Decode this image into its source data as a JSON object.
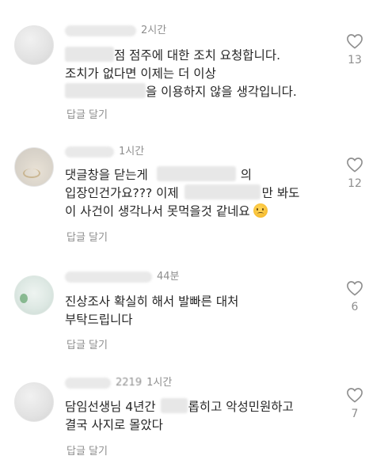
{
  "comments": [
    {
      "time": "2시간",
      "lines": [
        "점 점주에 대한 조치 요청합니다.",
        "조치가 없다면 이제는 더 이상",
        "을 이용하지 않을 생각입니다."
      ],
      "reply": "답글 달기",
      "likes": "13"
    },
    {
      "time": "1시간",
      "line1_a": "댓글창을 닫는게",
      "line1_b": "의",
      "line2_a": "입장인건가요??? 이제",
      "line2_b": "만 봐도",
      "line3": "이 사건이 생각나서 못먹을것 같네요",
      "emoji": "sad-face-emoji",
      "reply": "답글 달기",
      "likes": "12"
    },
    {
      "time": "44분",
      "lines": [
        "진상조사 확실히 해서 발빠른 대처",
        "부탁드립니다"
      ],
      "reply": "답글 달기",
      "likes": "6"
    },
    {
      "username_fragment": "2219",
      "time": "1시간",
      "line1_a": "담임선생님 4년간",
      "line1_b": "롭히고 악성민원하고",
      "line2": "결국 사지로 몰았다",
      "reply": "답글 달기",
      "likes": "7"
    }
  ],
  "icons": {
    "like": "heart-outline-icon"
  },
  "colors": {
    "text": "#262626",
    "muted": "#8e8e8e",
    "background": "#ffffff"
  }
}
